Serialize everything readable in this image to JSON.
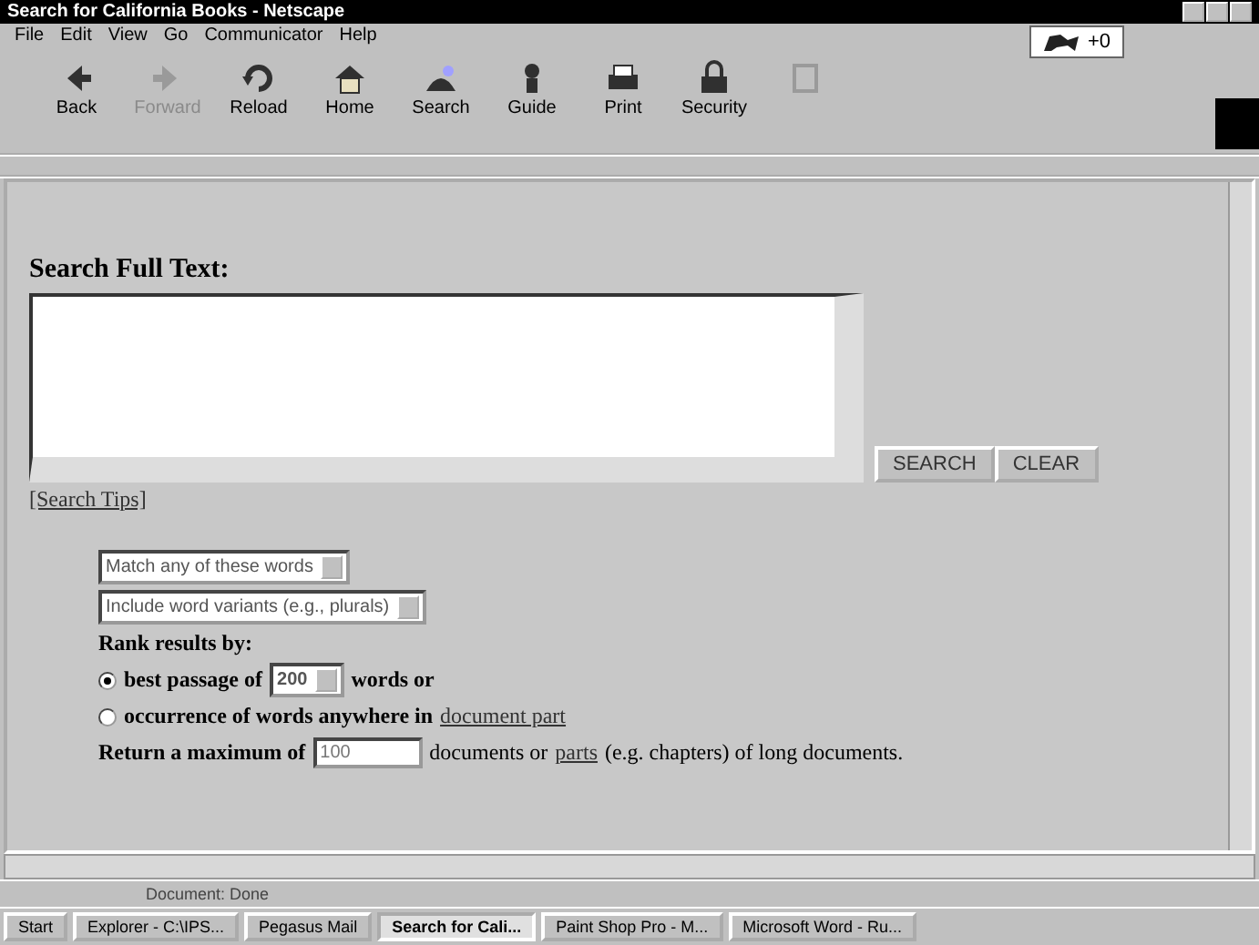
{
  "window": {
    "title": "Search for California Books - Netscape"
  },
  "menu": [
    "File",
    "Edit",
    "View",
    "Go",
    "Communicator",
    "Help"
  ],
  "toolbar": [
    {
      "kind": "back",
      "label": "Back",
      "disabled": false
    },
    {
      "kind": "forward",
      "label": "Forward",
      "disabled": true
    },
    {
      "kind": "reload",
      "label": "Reload",
      "disabled": false
    },
    {
      "kind": "home",
      "label": "Home",
      "disabled": false
    },
    {
      "kind": "search",
      "label": "Search",
      "disabled": false
    },
    {
      "kind": "guide",
      "label": "Guide",
      "disabled": false
    },
    {
      "kind": "print",
      "label": "Print",
      "disabled": false
    },
    {
      "kind": "security",
      "label": "Security",
      "disabled": false
    },
    {
      "kind": "stop",
      "disabled": true
    }
  ],
  "badge": "+0",
  "form": {
    "heading": "Search Full Text:",
    "buttons": [
      "SEARCH",
      "CLEAR"
    ],
    "tips_link": "[Search Tips]",
    "match_select": "Match any of these words",
    "variants_select": "Include word variants (e.g., plurals)",
    "rank_label": "Rank results by:",
    "rank_options": [
      {
        "selected": true,
        "before": "best passage of",
        "select": "200",
        "after": "words or"
      },
      {
        "selected": false,
        "before": "occurrence of words anywhere in",
        "link": "document part"
      }
    ],
    "return_before": "Return a maximum of",
    "return_value": "100",
    "return_middle": "documents or",
    "return_link": "parts",
    "return_after": "(e.g. chapters) of long documents."
  },
  "status_bar": "Document: Done",
  "taskbar": [
    {
      "label": "Start",
      "selected": false
    },
    {
      "label": "Explorer - C:\\IPS...",
      "selected": false
    },
    {
      "label": "Pegasus Mail",
      "selected": false
    },
    {
      "label": "Search for Cali...",
      "selected": true
    },
    {
      "label": "Paint Shop Pro - M...",
      "selected": false
    },
    {
      "label": "Microsoft Word - Ru...",
      "selected": false
    }
  ]
}
